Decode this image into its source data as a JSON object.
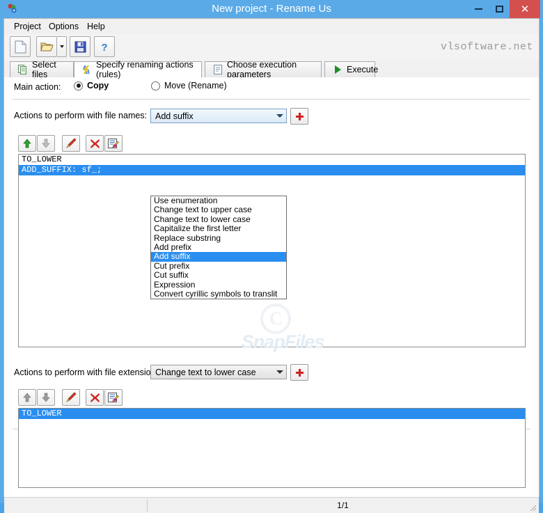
{
  "window": {
    "title": "New project - Rename Us",
    "app_icon": "app-icon",
    "minimize_label": "–",
    "maximize_label": "□",
    "close_label": "✕"
  },
  "menubar": {
    "items": [
      {
        "label": "Project"
      },
      {
        "label": "Options"
      },
      {
        "label": "Help"
      }
    ]
  },
  "toolbar": {
    "buttons": [
      {
        "name": "new-project-button",
        "icon": "new-document-icon"
      },
      {
        "name": "open-project-button",
        "icon": "open-folder-icon"
      },
      {
        "name": "save-project-button",
        "icon": "floppy-save-icon"
      },
      {
        "name": "help-button",
        "icon": "question-mark-icon"
      }
    ],
    "brand": "vlsoftware.net"
  },
  "tabs": [
    {
      "label": "Select files",
      "icon": "files-icon",
      "active": false
    },
    {
      "label": "Specify renaming actions (rules)",
      "icon": "ab-letters-icon",
      "active": true
    },
    {
      "label": "Choose execution parameters",
      "icon": "parameters-icon",
      "active": false
    },
    {
      "label": "Execute",
      "icon": "play-triangle-icon",
      "active": false
    }
  ],
  "main_action": {
    "label": "Main action:",
    "options": [
      {
        "label": "Copy",
        "selected": true
      },
      {
        "label": "Move (Rename)",
        "selected": false
      }
    ]
  },
  "file_names_section": {
    "label": "Actions to perform with file names:",
    "combo_value": "Add suffix",
    "add_button_label": "+",
    "action_buttons": [
      {
        "name": "move-up-button",
        "icon": "arrow-up-icon"
      },
      {
        "name": "move-down-button",
        "icon": "arrow-down-icon"
      },
      {
        "name": "edit-rule-button",
        "icon": "pen-icon"
      },
      {
        "name": "delete-rule-button",
        "icon": "red-x-icon"
      },
      {
        "name": "edit-properties-button",
        "icon": "edit-document-icon"
      }
    ],
    "rules": [
      {
        "text": "TO_LOWER",
        "selected": false
      },
      {
        "text": "ADD_SUFFIX: sf_;",
        "selected": true
      }
    ]
  },
  "dropdown": {
    "open": true,
    "items": [
      {
        "label": "Use enumeration",
        "selected": false
      },
      {
        "label": "Change text to upper case",
        "selected": false
      },
      {
        "label": "Change text to lower case",
        "selected": false
      },
      {
        "label": "Capitalize the first letter",
        "selected": false
      },
      {
        "label": "Replace substring",
        "selected": false
      },
      {
        "label": "Add prefix",
        "selected": false
      },
      {
        "label": "Add suffix",
        "selected": true
      },
      {
        "label": "Cut prefix",
        "selected": false
      },
      {
        "label": "Cut suffix",
        "selected": false
      },
      {
        "label": "Expression",
        "selected": false
      },
      {
        "label": "Convert cyrillic symbols to translit",
        "selected": false
      }
    ]
  },
  "file_extensions_section": {
    "label": "Actions to perform with file extensions:",
    "combo_value": "Change text to lower case",
    "add_button_label": "+",
    "action_buttons": [
      {
        "name": "move-up-button",
        "icon": "arrow-up-icon"
      },
      {
        "name": "move-down-button",
        "icon": "arrow-down-icon"
      },
      {
        "name": "edit-rule-button",
        "icon": "pen-icon"
      },
      {
        "name": "delete-rule-button",
        "icon": "red-x-icon"
      },
      {
        "name": "edit-properties-button",
        "icon": "edit-document-icon"
      }
    ],
    "rules": [
      {
        "text": "TO_LOWER",
        "selected": true
      }
    ]
  },
  "watermark": {
    "copyright_symbol": "C",
    "text": "SnapFiles"
  },
  "statusbar": {
    "left_text": "",
    "count": "1/1"
  },
  "colors": {
    "titlebar": "#5aaae8",
    "close_button": "#d4504e",
    "selection": "#2a8ef0",
    "accent_red": "#cc2222",
    "panel": "#ffffff"
  }
}
